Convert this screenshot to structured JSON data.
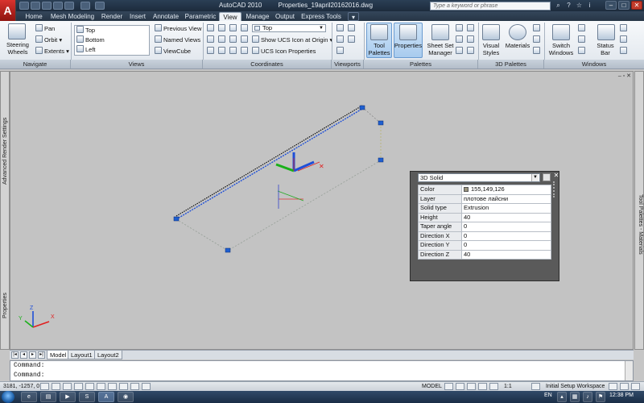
{
  "titlebar": {
    "app": "AutoCAD 2010",
    "file": "Properties_19april20162016.dwg",
    "search_placeholder": "Type a keyword or phrase",
    "logo": "A"
  },
  "ribbon_tabs": [
    "Home",
    "Mesh Modeling",
    "Render",
    "Insert",
    "Annotate",
    "Parametric",
    "View",
    "Manage",
    "Output",
    "Express Tools"
  ],
  "active_tab": "View",
  "ribbon": {
    "navigate": {
      "title": "Navigate",
      "steering": "Steering\nWheels",
      "pan": "Pan",
      "orbit": "Orbit",
      "extents": "Extents"
    },
    "views": {
      "title": "Views",
      "list": [
        "Top",
        "Bottom",
        "Left"
      ],
      "previous": "Previous View",
      "named": "Named Views",
      "viewcube": "ViewCube"
    },
    "coordinates": {
      "title": "Coordinates",
      "ucs_combo": "Top",
      "show_ucs": "Show UCS Icon at Origin",
      "ucs_props": "UCS Icon Properties"
    },
    "viewports": {
      "title": "Viewports"
    },
    "palettes": {
      "title": "Palettes",
      "tool_palettes": "Tool\nPalettes",
      "properties": "Properties",
      "sheet_set": "Sheet Set\nManager"
    },
    "palettes3d": {
      "title": "3D Palettes",
      "visual_styles": "Visual\nStyles",
      "materials": "Materials"
    },
    "windows": {
      "title": "Windows",
      "switch_windows": "Switch\nWindows",
      "status_bar": "Status\nBar"
    }
  },
  "side_panels": {
    "left_top": "Advanced Render Settings",
    "left_bottom": "Properties",
    "right": "Tool Palettes - Materials"
  },
  "properties_palette": {
    "object_type": "3D Solid",
    "rows": [
      {
        "label": "Color",
        "value": "155,149,126",
        "swatch": "#9b957e"
      },
      {
        "label": "Layer",
        "value": "плотове лайсни"
      },
      {
        "label": "Solid type",
        "value": "Extrusion"
      },
      {
        "label": "Height",
        "value": "40"
      },
      {
        "label": "Taper angle",
        "value": "0"
      },
      {
        "label": "Direction X",
        "value": "0"
      },
      {
        "label": "Direction Y",
        "value": "0"
      },
      {
        "label": "Direction Z",
        "value": "40"
      }
    ]
  },
  "layout_tabs": [
    "Model",
    "Layout1",
    "Layout2"
  ],
  "active_layout": "Model",
  "command_lines": [
    "Command:",
    "Command:"
  ],
  "statusbar": {
    "coords": "3181, -1257, 0",
    "model": "MODEL",
    "scale": "1:1",
    "workspace": "Initial Setup Workspace"
  },
  "taskbar": {
    "language": "EN",
    "time": "12:38 PM"
  },
  "colors": {
    "accent_blue": "#1e4fd8",
    "axis_red": "#e02020",
    "axis_green": "#19b019",
    "grip_blue": "#1f5fd0"
  }
}
